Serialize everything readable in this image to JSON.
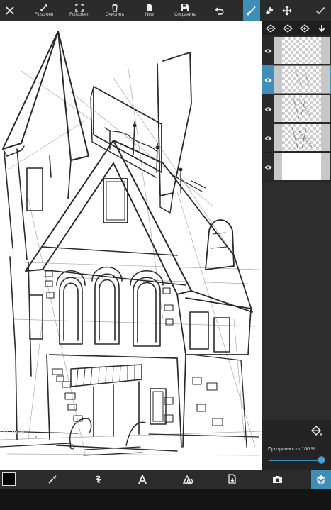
{
  "toolbar": {
    "fit_screen_label": "Fit screen",
    "fullscreen_label": "Fullscreen",
    "clear_label": "Очистить",
    "new_label": "New",
    "save_label": "Сохранить"
  },
  "layers_panel": {
    "layers": [
      {
        "visible": true,
        "selected": false,
        "thumb": "transparent"
      },
      {
        "visible": true,
        "selected": true,
        "thumb": "transparent"
      },
      {
        "visible": true,
        "selected": false,
        "thumb": "transparent"
      },
      {
        "visible": true,
        "selected": false,
        "thumb": "transparent"
      },
      {
        "visible": true,
        "selected": false,
        "thumb": "background"
      }
    ],
    "blend_mode": "Normal",
    "opacity_label": "Прозрачность",
    "opacity_value": "100 %",
    "opacity": 1.0
  },
  "bottom_toolbar": {
    "current_color": "#000000",
    "tools": [
      "eyedropper-icon",
      "brush-style-icon",
      "text-icon",
      "shape-icon",
      "import-icon",
      "camera-icon",
      "layers-icon"
    ]
  },
  "colors": {
    "accent": "#3d8fb8",
    "toolbar_bg": "#2b2b2b",
    "panel_bg": "#2d2d2d"
  }
}
